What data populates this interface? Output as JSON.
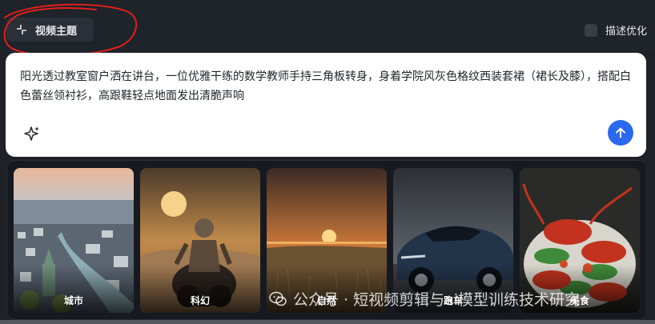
{
  "header": {
    "theme_button_label": "视频主题",
    "theme_button_icon": "collapse-arrows-icon",
    "optimize_label": "描述优化"
  },
  "prompt": {
    "text": "阳光透过教室窗户洒在讲台，一位优雅干练的数学教师手持三角板转身，身着学院风灰色格纹西装套裙（裙长及膝），搭配白色蕾丝领衬衫，高跟鞋轻点地面发出清脆声响",
    "enhance_icon": "sparkle-icon",
    "send_icon": "arrow-up-icon"
  },
  "gallery": {
    "tiles": [
      {
        "label": "城市"
      },
      {
        "label": "科幻"
      },
      {
        "label": "自然"
      },
      {
        "label": "跑车"
      },
      {
        "label": "美食"
      }
    ]
  },
  "watermark": {
    "text": "公众号 · 短视频剪辑与ai模型训练技术研究"
  },
  "colors": {
    "background": "#1e2128",
    "accent": "#2a68ee",
    "scribble": "#e0201b"
  }
}
